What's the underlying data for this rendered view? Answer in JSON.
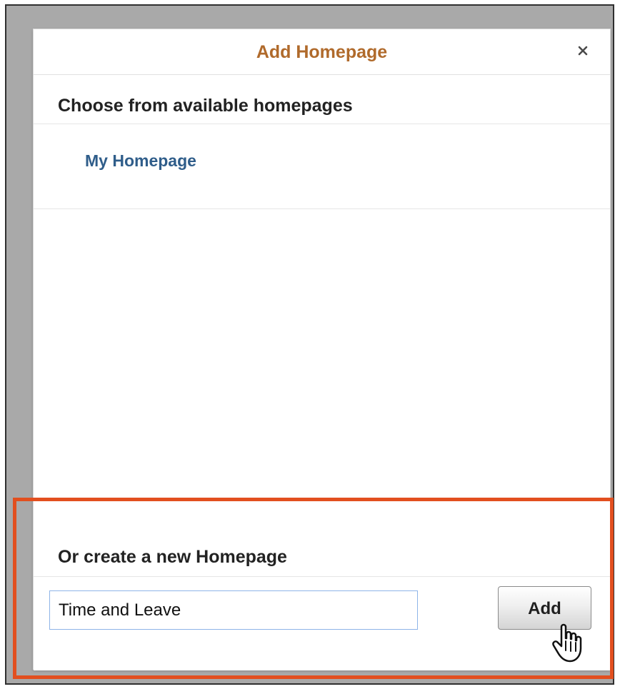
{
  "dialog": {
    "title": "Add Homepage",
    "close_icon": "close-icon"
  },
  "choose_section": {
    "heading": "Choose from available homepages",
    "items": [
      {
        "label": "My Homepage"
      }
    ]
  },
  "create_section": {
    "heading": "Or create a new Homepage",
    "input_value": "Time and Leave",
    "add_label": "Add"
  },
  "annotations": {
    "highlight_color": "#e24f1f"
  },
  "colors": {
    "title": "#b06a2b",
    "link": "#2f5d8a",
    "input_border": "#8eb4e8"
  },
  "cursor_icon": "hand-pointer-icon"
}
